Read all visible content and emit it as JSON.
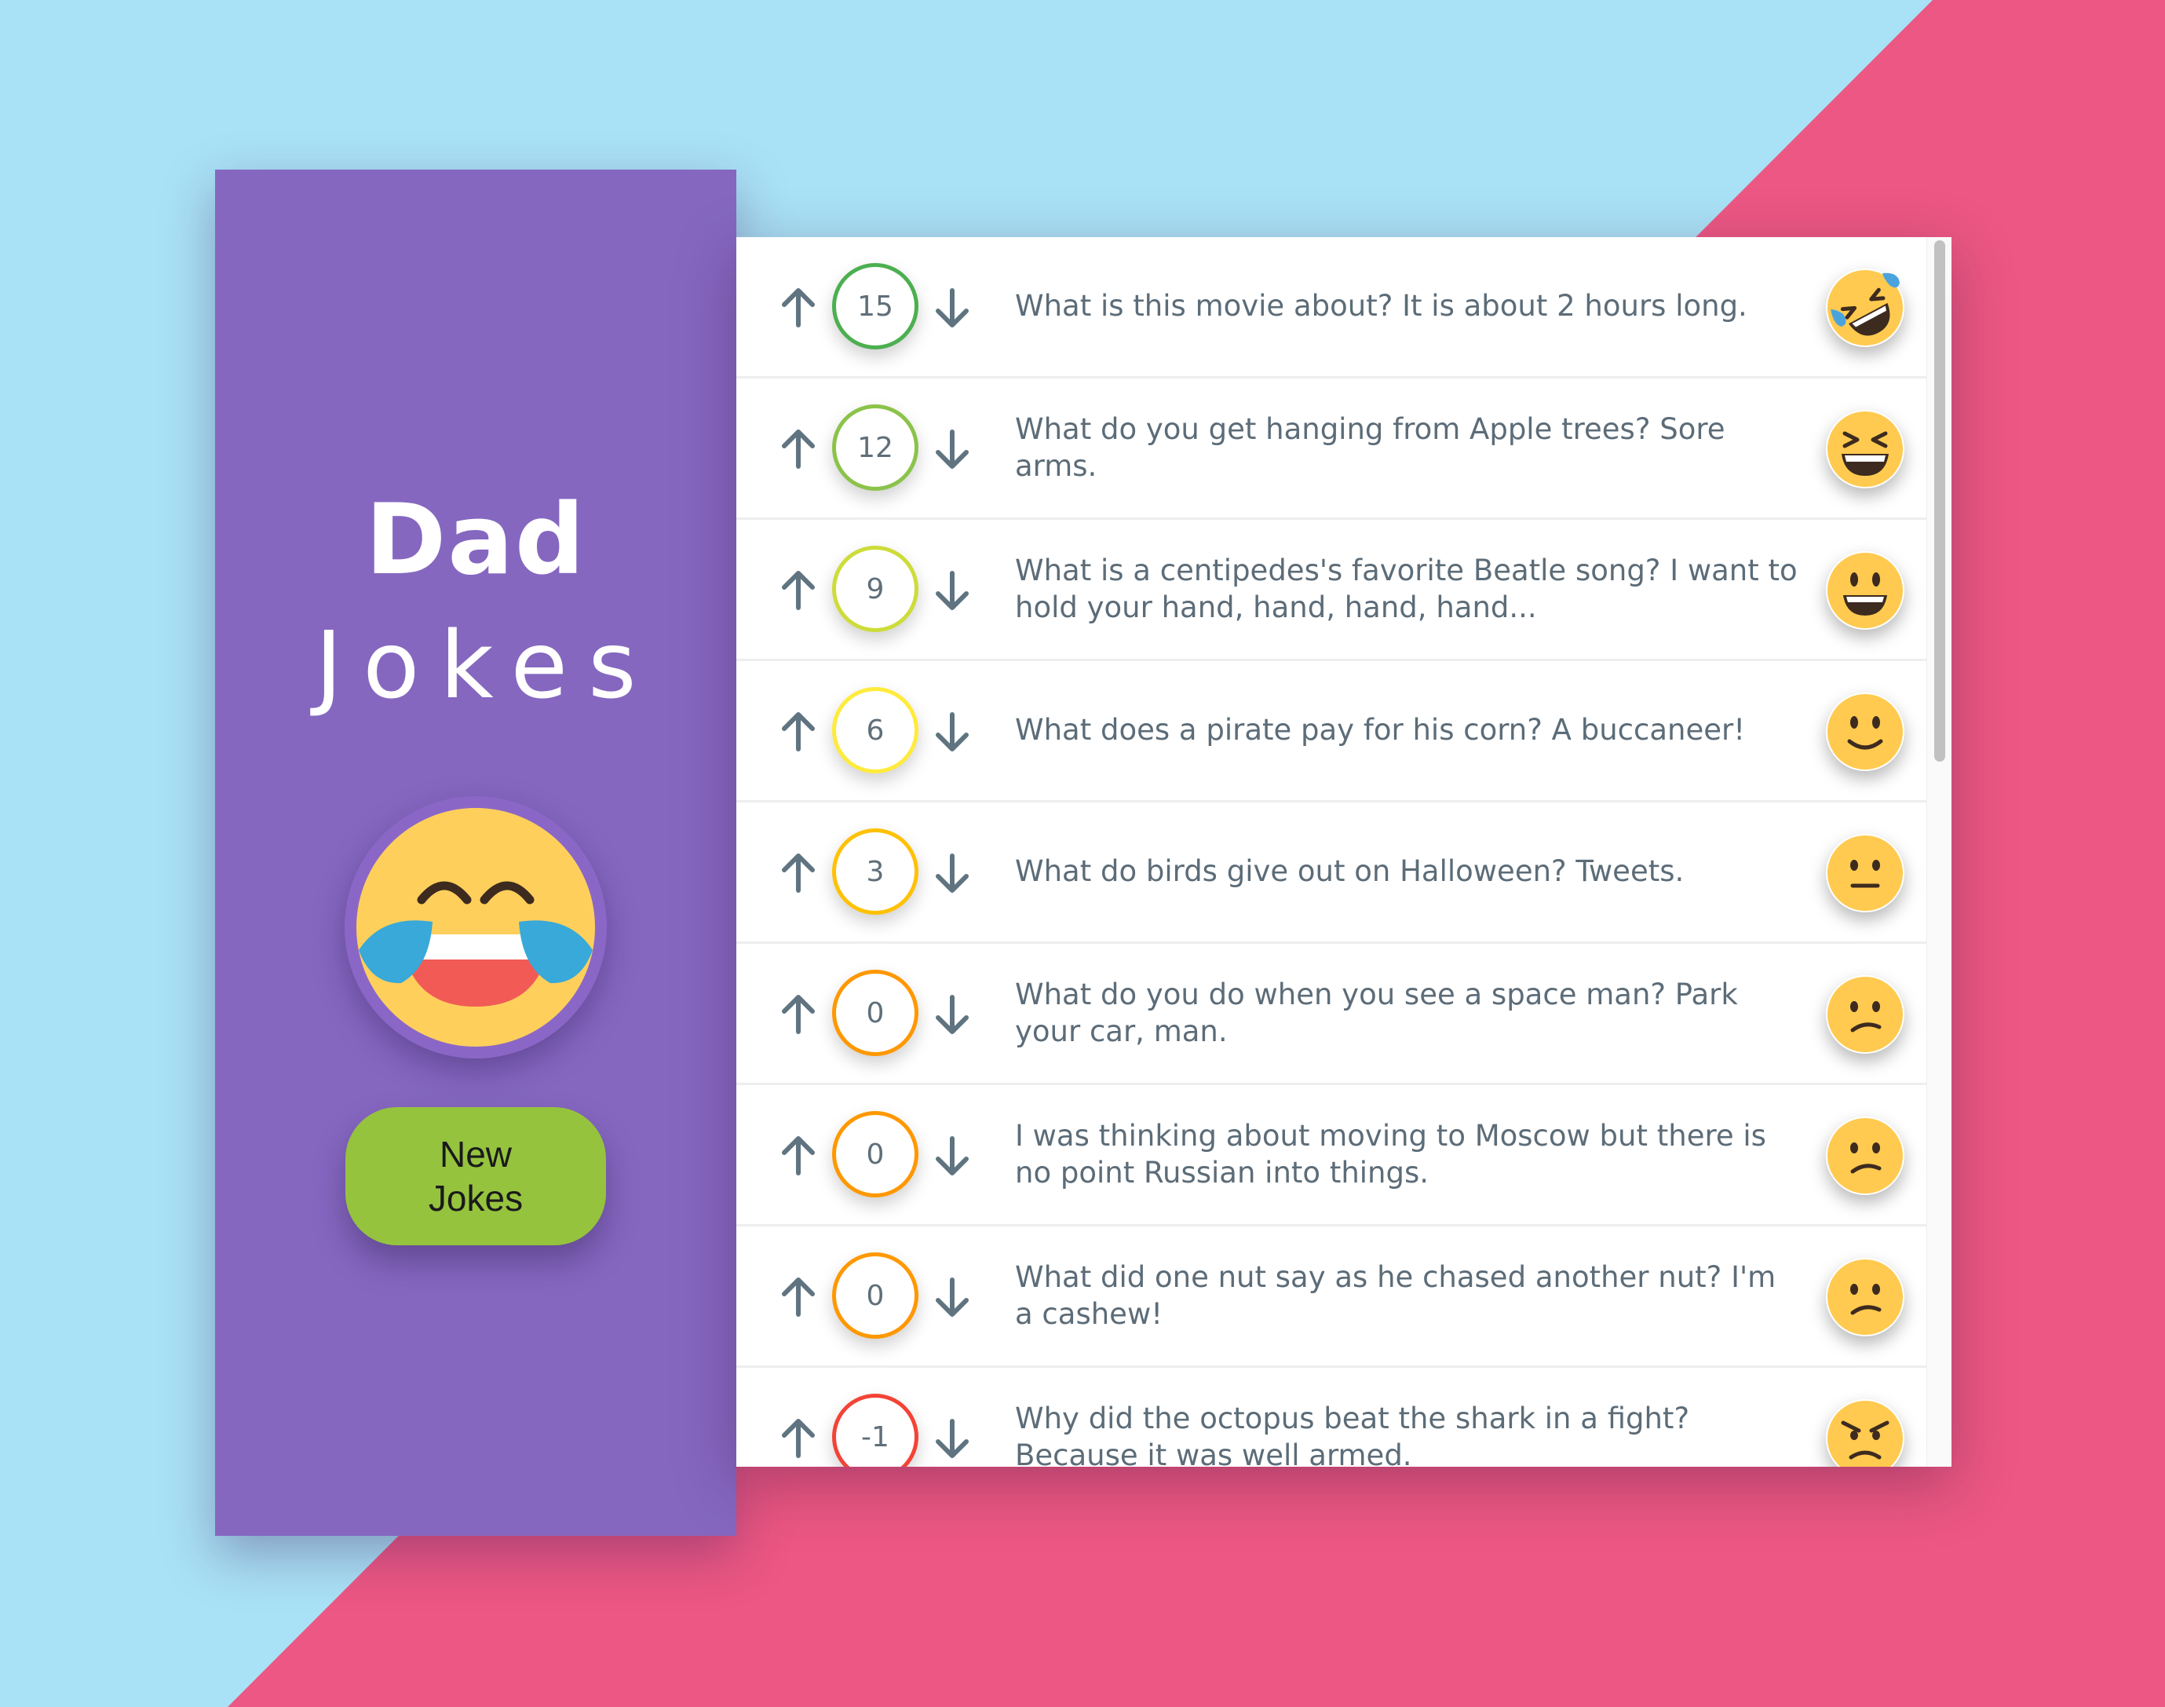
{
  "app": {
    "title_line1": "Dad",
    "title_line2": "Jokes",
    "header_icon": "laughing-tears-emoji-icon",
    "new_jokes_label": "New Jokes"
  },
  "colors": {
    "bg_blue": "#A9E1F6",
    "bg_pink": "#EC5783",
    "sidebar": "#8567C0",
    "button": "#95C33E"
  },
  "jokes": [
    {
      "votes": "15",
      "text": "What is this movie about? It is about 2 hours long.",
      "emoji": "rolling-on-floor-laughing-icon",
      "color": "#4CAF50"
    },
    {
      "votes": "12",
      "text": "What do you get hanging from Apple trees? Sore arms.",
      "emoji": "grinning-squinting-face-icon",
      "color": "#8BC34A"
    },
    {
      "votes": "9",
      "text": "What is a centipedes's favorite Beatle song? I want to hold your hand, hand, hand, hand...",
      "emoji": "grinning-face-big-eyes-icon",
      "color": "#CDDC39"
    },
    {
      "votes": "6",
      "text": "What does a pirate pay for his corn? A buccaneer!",
      "emoji": "slightly-smiling-face-icon",
      "color": "#FFEB3B"
    },
    {
      "votes": "3",
      "text": "What do birds give out on Halloween? Tweets.",
      "emoji": "neutral-face-icon",
      "color": "#FFC107"
    },
    {
      "votes": "0",
      "text": "What do you do when you see a space man? Park your car, man.",
      "emoji": "confused-face-icon",
      "color": "#FF9800"
    },
    {
      "votes": "0",
      "text": "I was thinking about moving to Moscow but there is no point Russian into things.",
      "emoji": "confused-face-icon",
      "color": "#FF9800"
    },
    {
      "votes": "0",
      "text": "What did one nut say as he chased another nut? I'm a cashew!",
      "emoji": "confused-face-icon",
      "color": "#FF9800"
    },
    {
      "votes": "-1",
      "text": "Why did the octopus beat the shark in a fight? Because it was well armed.",
      "emoji": "angry-face-icon",
      "color": "#F44336"
    }
  ]
}
